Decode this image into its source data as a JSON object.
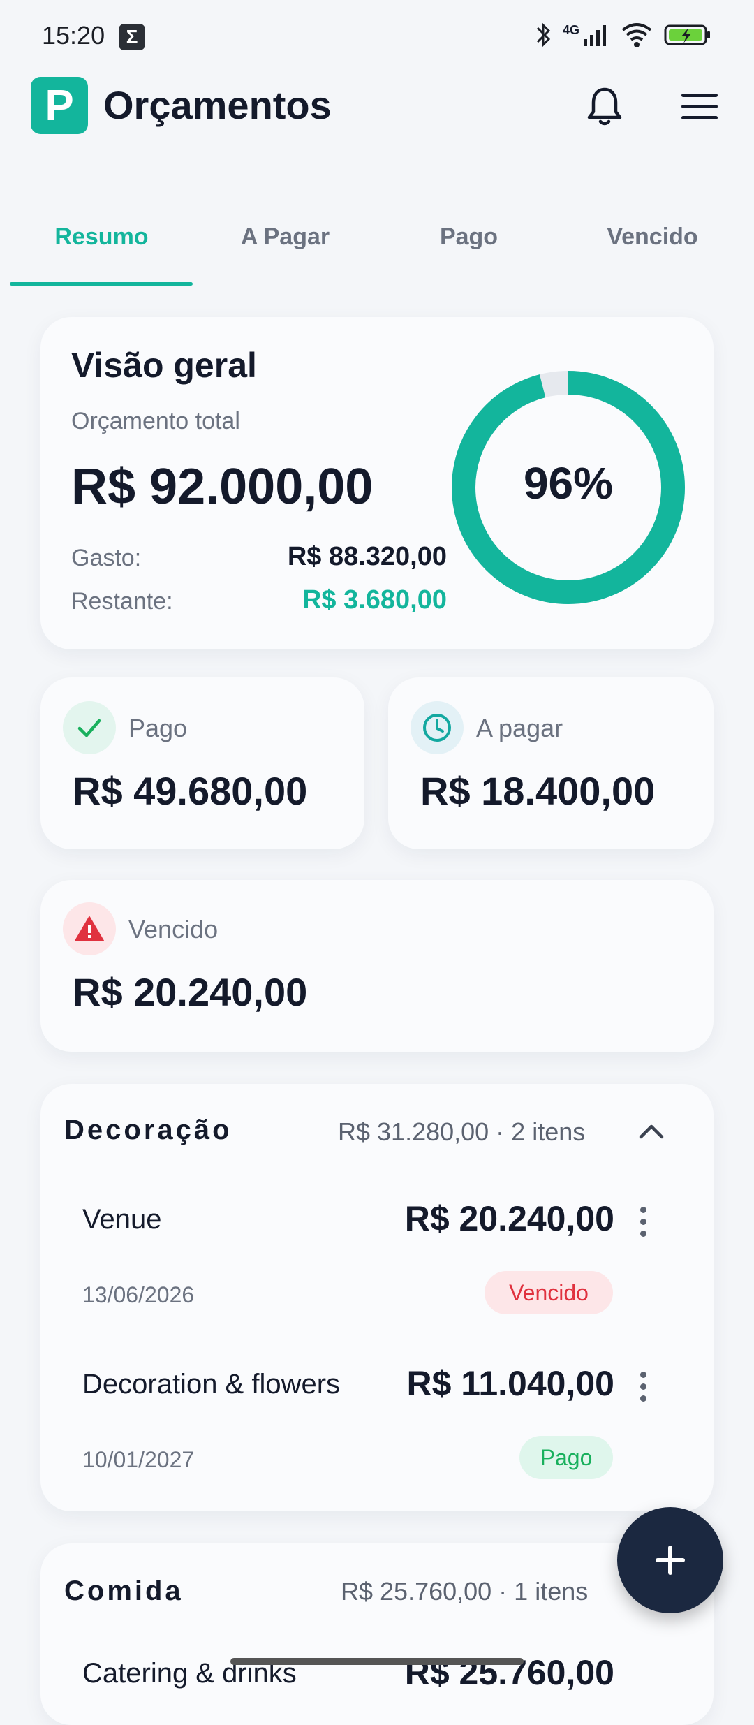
{
  "status": {
    "time": "15:20",
    "network": "4G"
  },
  "header": {
    "logo_letter": "P",
    "title": "Orçamentos"
  },
  "tabs": [
    {
      "label": "Resumo",
      "active": true
    },
    {
      "label": "A Pagar",
      "active": false
    },
    {
      "label": "Pago",
      "active": false
    },
    {
      "label": "Vencido",
      "active": false
    }
  ],
  "overview": {
    "title": "Visão geral",
    "subtitle": "Orçamento total",
    "total": "R$ 92.000,00",
    "spent_label": "Gasto:",
    "spent_value": "R$ 88.320,00",
    "remaining_label": "Restante:",
    "remaining_value": "R$ 3.680,00",
    "percent_label": "96%",
    "percent_value": 0.96
  },
  "stats": {
    "paid": {
      "label": "Pago",
      "value": "R$ 49.680,00"
    },
    "to_pay": {
      "label": "A pagar",
      "value": "R$ 18.400,00"
    },
    "overdue": {
      "label": "Vencido",
      "value": "R$ 20.240,00"
    }
  },
  "categories": [
    {
      "name": "Decoração",
      "summary": "R$ 31.280,00 · 2 itens",
      "items": [
        {
          "name": "Venue",
          "amount": "R$ 20.240,00",
          "date": "13/06/2026",
          "status": "Vencido"
        },
        {
          "name": "Decoration & flowers",
          "amount": "R$ 11.040,00",
          "date": "10/01/2027",
          "status": "Pago"
        }
      ]
    },
    {
      "name": "Comida",
      "summary": "R$ 25.760,00 · 1 itens",
      "items": [
        {
          "name": "Catering & drinks",
          "amount": "R$ 25.760,00"
        }
      ]
    }
  ],
  "colors": {
    "accent": "#13b59c",
    "danger": "#e0323f",
    "success": "#19b05d",
    "fab": "#1b2840"
  }
}
